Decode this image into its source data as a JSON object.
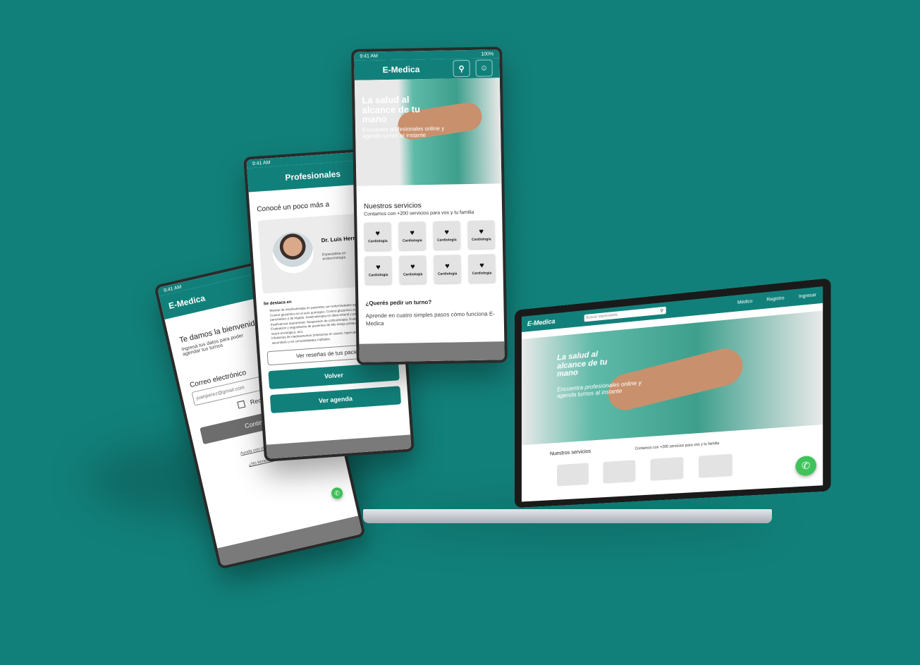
{
  "brand": "E-Medica",
  "accent_color": "#12807a",
  "status_time": "9:41 AM",
  "status_battery": "100%",
  "login_screen": {
    "title": "E-Medica",
    "welcome": "Te damos la bienvenida",
    "subtitle": "Ingresá tus datos para poder agendar tus turnos",
    "email_label": "Correo electrónico",
    "email_placeholder": "juanperez@gmail.com",
    "remember_label": "Recordarme",
    "continue_button": "Continuar",
    "help_link": "Ayuda con el ingreso",
    "no_account_link": "¿No tienes cuenta?"
  },
  "professional_screen": {
    "title": "Profesionales",
    "heading": "Conocé un poco más a",
    "doctor_name": "Dr. Luis Hernandez",
    "specialty": "Especialista en endocrinología",
    "stars": "★★",
    "highlights_title": "Se destaca en",
    "highlights": [
      "Manejo de insulinoterapia en pacientes con enfermedades agudas. Bombas de insulina.",
      "Control glucémico en el acto quirúrgico. Control glucémico durante el trasplante pancreático y de hígado. Insulinoterapia en dieta enteral y parenteral.",
      "Insuficiencia suprarrenal. Suspensión de corticoterapia. Evaluación endocrinológica. Evaluación y seguimiento de pacientes de alto riesgo postquirúrgico (renal, hepático, neuro-oncológico, etc).",
      "Infusiones de medicamentos (infusiones en cáncer, hipercalcemia, etc). Cuidado secundario y en comorbilidades múltiples."
    ],
    "reviews_button": "Ver reseñas de tus pacientes",
    "back_button": "Volver",
    "schedule_button": "Ver agenda"
  },
  "home_screen": {
    "title": "E-Medica",
    "hero_title": "La salud al alcance de tu mano",
    "hero_subtitle": "Encuentra profesionales online y agenda turnos al instante",
    "services_title": "Nuestros servicios",
    "services_subtitle": "Contamos con +200 servicios para vos y tu familia",
    "services": [
      "Cardiología",
      "Cardiología",
      "Cardiología",
      "Cardiología",
      "Cardiología",
      "Cardiología",
      "Cardiología",
      "Cardiología"
    ],
    "turn_title": "¿Querés pedir un turno?",
    "turn_text": "Aprende en cuatro simples pasos cómo funciona E-Medica"
  },
  "desktop": {
    "brand": "E-Medica",
    "search_placeholder": "Buscar especialista",
    "nav": [
      "Médico",
      "Registro",
      "Ingresar"
    ],
    "hero_title": "La salud al alcance de tu mano",
    "hero_subtitle": "Encuentra profesionales online y agenda turnos al instante",
    "services_title": "Nuestros servicios",
    "services_subtitle": "Contamos con +200 servicios para vos y tu familia"
  }
}
